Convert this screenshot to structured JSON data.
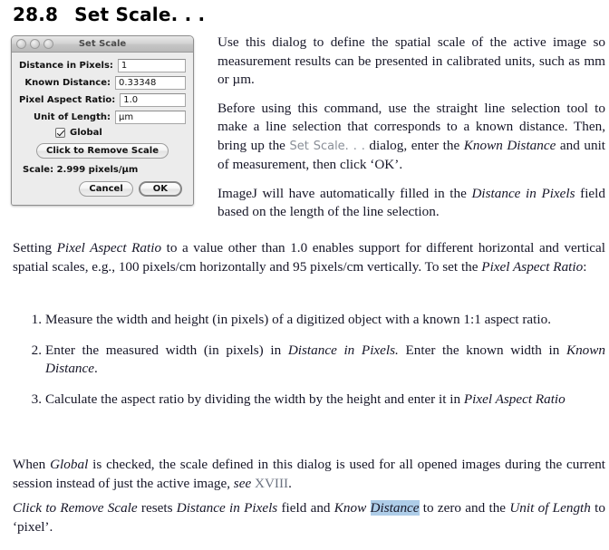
{
  "heading": {
    "number": "28.8",
    "title": "Set Scale. . ."
  },
  "dialog": {
    "title": "Set Scale",
    "window_controls": [
      "close-button",
      "minimize-button",
      "zoom-button"
    ],
    "fields": [
      {
        "label": "Distance in Pixels:",
        "value": "1"
      },
      {
        "label": "Known Distance:",
        "value": "0.33348"
      },
      {
        "label": "Pixel Aspect Ratio:",
        "value": "1.0"
      },
      {
        "label": "Unit of Length:",
        "value": "µm"
      }
    ],
    "global_checkbox": {
      "label": "Global",
      "checked": true
    },
    "remove_scale_button": "Click to Remove Scale",
    "scale_readout": "Scale: 2.999 pixels/µm",
    "cancel_button": "Cancel",
    "ok_button": "OK"
  },
  "paragraphs": {
    "intro_1_a": "Use this dialog to define the spatial scale of the active image so measurement results can be presented in calibrated units, such as mm or µm.",
    "intro_2_a": "Before using this command, use the straight line selection tool to make a line selection that corresponds to a known distance. Then, bring up the ",
    "intro_2_link": "Set Scale. . .",
    "intro_2_b": " dialog, enter the ",
    "intro_2_em": "Known Distance",
    "intro_2_c": " and unit of measurement, then click ‘OK’.",
    "intro_3_a": "ImageJ will have automatically filled in the ",
    "intro_3_em": "Distance in Pixels",
    "intro_3_b": " field based on the length of the line selection.",
    "setting_a": "Setting ",
    "setting_em1": "Pixel Aspect Ratio",
    "setting_b": " to a value other than 1.0 enables support for different horizontal and vertical spatial scales, e.g., 100 pixels/cm horizontally and 95 pixels/cm vertically. To set the ",
    "setting_em2": "Pixel Aspect Ratio",
    "setting_c": ":",
    "global_a": "When ",
    "global_em": "Global",
    "global_b": " is checked, the scale defined in this dialog is used for all opened images during the current session instead of just the active image, ",
    "global_see": "see",
    "global_ref": "XVIII",
    "global_c": ".",
    "remove_em1": "Click to Remove Scale",
    "remove_a": " resets ",
    "remove_em2": "Distance in Pixels",
    "remove_b": " field and ",
    "remove_em3": "Know ",
    "remove_em3_hl": "Distance",
    "remove_c": " to zero and the ",
    "remove_em4": "Unit of Length",
    "remove_d": " to ‘pixel’."
  },
  "steps": [
    {
      "num": "1.",
      "a": "Measure the width and height (in pixels) of a digitized object with a known 1:1 aspect ratio.",
      "em": "",
      "b": ""
    },
    {
      "num": "2.",
      "a": "Enter the measured width (in pixels) in ",
      "em": "Distance in Pixels.",
      "b": " Enter the known width in ",
      "em2": "Known Distance",
      "c": "."
    },
    {
      "num": "3.",
      "a": "Calculate the aspect ratio by dividing the width by the height and enter it in ",
      "em": "Pixel Aspect Ratio",
      "b": ""
    }
  ],
  "colors": {
    "highlight": "#aecde8",
    "link_gray": "#6b7280",
    "text": "#161627"
  }
}
